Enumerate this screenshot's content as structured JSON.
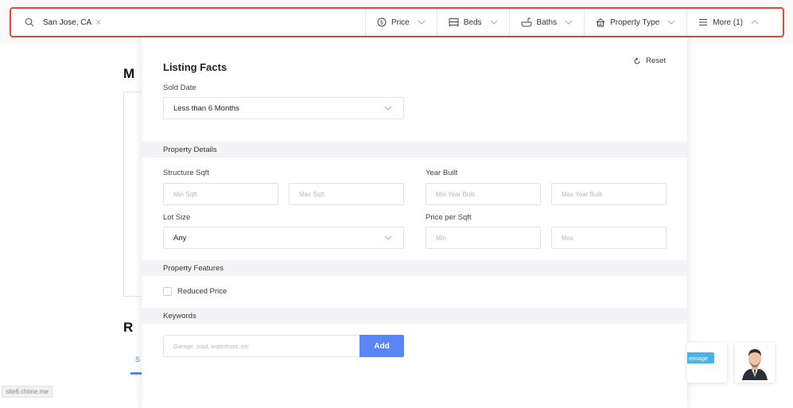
{
  "search": {
    "location_chip": "San Jose, CA"
  },
  "filters": [
    {
      "label": "Price",
      "icon": "dollar-circle-icon"
    },
    {
      "label": "Beds",
      "icon": "bed-icon"
    },
    {
      "label": "Baths",
      "icon": "bathtub-icon"
    },
    {
      "label": "Property Type",
      "icon": "house-icon"
    },
    {
      "label": "More (1)",
      "icon": "list-icon"
    }
  ],
  "background": {
    "heading1": "M",
    "heading2": "R",
    "tab_label": "S",
    "site_url": "site6.chime.me"
  },
  "panel": {
    "title": "Listing Facts",
    "reset_label": "Reset",
    "sold_date": {
      "label": "Sold Date",
      "value": "Less than 6 Months"
    },
    "sections": {
      "property_details": "Property Details",
      "property_features": "Property Features",
      "keywords": "Keywords"
    },
    "structure_sqft": {
      "label": "Structure Sqft",
      "min_placeholder": "Min Sqft",
      "max_placeholder": "Max Sqft"
    },
    "year_built": {
      "label": "Year Built",
      "min_placeholder": "Min Year Built",
      "max_placeholder": "Max Year Built"
    },
    "lot_size": {
      "label": "Lot Size",
      "value": "Any"
    },
    "price_per_sqft": {
      "label": "Price per Sqft",
      "min_placeholder": "Min",
      "max_placeholder": "Max"
    },
    "reduced_price": {
      "label": "Reduced Price",
      "checked": false
    },
    "keywords_input": {
      "placeholder": "Garage, pool, waterfront, etc"
    },
    "add_label": "Add"
  },
  "chat": {
    "message_badge": "essage"
  },
  "colors": {
    "accent": "#5a86f5",
    "highlight_border": "#e8453c",
    "badge": "#45b4e8"
  }
}
